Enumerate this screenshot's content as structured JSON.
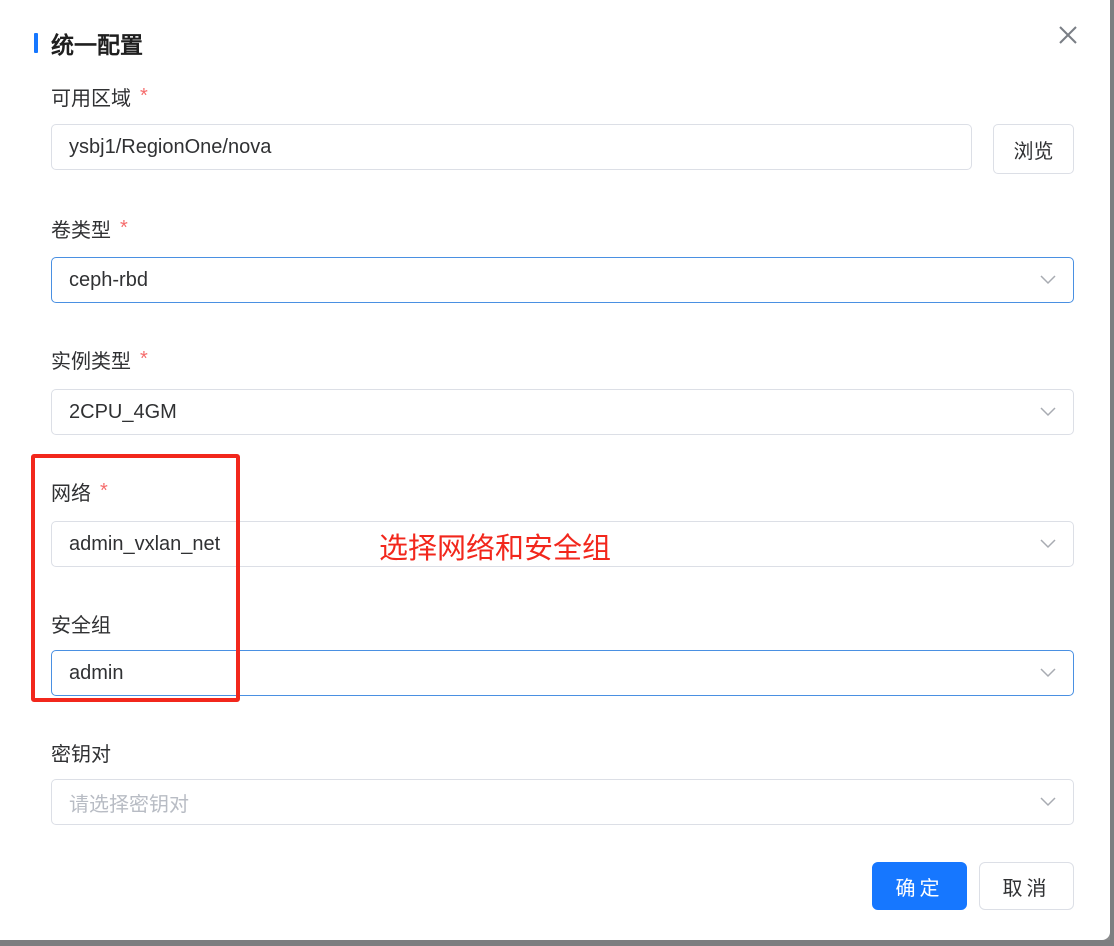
{
  "dialog": {
    "title": "统一配置",
    "close_icon": "close-icon"
  },
  "fields": {
    "zone": {
      "label": "可用区域",
      "required_mark": "*",
      "value": "ysbj1/RegionOne/nova",
      "browse_label": "浏览"
    },
    "volume_type": {
      "label": "卷类型",
      "required_mark": "*",
      "value": "ceph-rbd"
    },
    "instance_type": {
      "label": "实例类型",
      "required_mark": "*",
      "value": "2CPU_4GM"
    },
    "network": {
      "label": "网络",
      "required_mark": "*",
      "value": "admin_vxlan_net"
    },
    "security_group": {
      "label": "安全组",
      "value": "admin"
    },
    "keypair": {
      "label": "密钥对",
      "placeholder": "请选择密钥对"
    }
  },
  "annotation": {
    "text": "选择网络和安全组",
    "color": "#f2271c"
  },
  "footer": {
    "confirm_label": "确定",
    "cancel_label": "取消"
  },
  "colors": {
    "primary": "#1677ff",
    "required": "#f56c6c",
    "annotation": "#f2271c"
  }
}
